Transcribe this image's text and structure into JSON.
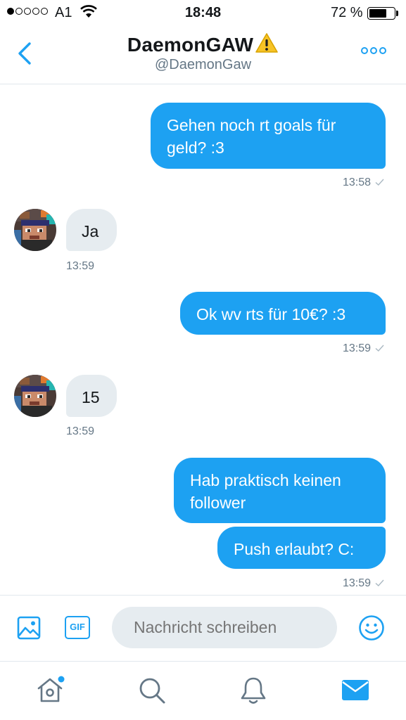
{
  "status_bar": {
    "carrier": "A1",
    "time": "18:48",
    "battery_percent": "72 %",
    "battery_level": 0.72,
    "signal_bars": 1
  },
  "header": {
    "title": "DaemonGAW",
    "handle": "@DaemonGaw",
    "icons": {
      "back": "chevron-left-icon",
      "warning": "warning-icon",
      "more": "more-icon"
    }
  },
  "messages": [
    {
      "direction": "out",
      "text": "Gehen noch rt goals für geld? :3",
      "time": "13:58",
      "read": true
    },
    {
      "direction": "in",
      "text": "Ja",
      "time": "13:59"
    },
    {
      "direction": "out",
      "text": "Ok wv rts für 10€? :3",
      "time": "13:59",
      "read": true
    },
    {
      "direction": "in",
      "text": "15",
      "time": "13:59"
    },
    {
      "direction": "out",
      "text": "Hab praktisch keinen follower",
      "time": ""
    },
    {
      "direction": "out",
      "text": "Push erlaubt? C:",
      "time": "13:59",
      "read": true
    }
  ],
  "composer": {
    "placeholder": "Nachricht schreiben",
    "gif_label": "GIF",
    "icons": {
      "photo": "photo-icon",
      "emoji": "emoji-icon"
    }
  },
  "tabbar": {
    "tabs": [
      "home-icon",
      "search-icon",
      "notifications-icon",
      "messages-icon"
    ],
    "active": "messages-icon",
    "home_has_badge": true
  },
  "colors": {
    "accent": "#1da1f2",
    "incoming_bubble": "#e6ecf0",
    "secondary_text": "#657786",
    "warning": "#f7c325"
  }
}
